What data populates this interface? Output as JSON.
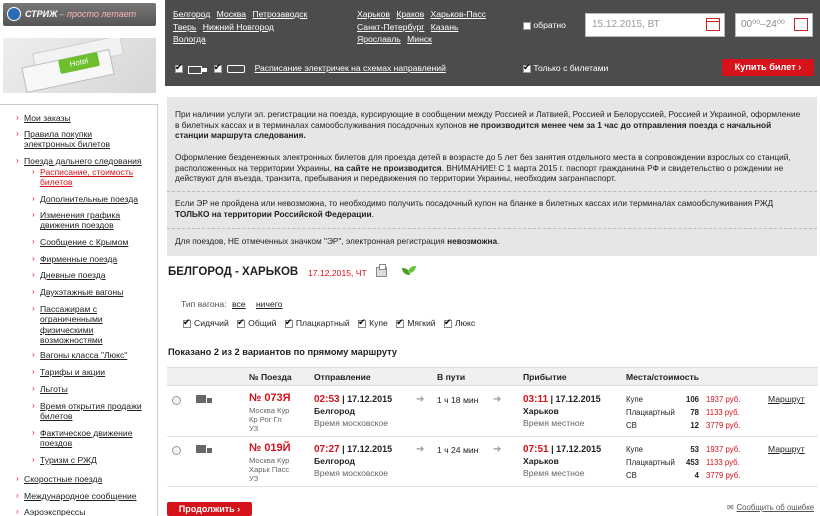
{
  "logo": {
    "brand": "СТРИЖ",
    "slogan": "– просто летает"
  },
  "hotel_banner": {
    "label": "Hotel"
  },
  "search": {
    "from_cities": [
      "Белгород",
      "Москва",
      "Петрозаводск",
      "Тверь",
      "Нижний Новгород",
      "Вологда"
    ],
    "to_cities": [
      "Харьков",
      "Краков",
      "Харьков-Пасс",
      "Санкт-Петербург",
      "Казань",
      "Ярославль",
      "Минск"
    ],
    "round_trip_label": "обратно",
    "date_value": "15.12.2015, ВТ",
    "time_value": "00⁰⁰–24⁰⁰",
    "suburban_link": "Расписание электричек на схемах направлений",
    "only_tickets_label": "Только с билетами",
    "buy_button": "Купить билет ›"
  },
  "sidebar": {
    "items": [
      "Мои заказы",
      "Правила покупки электронных билетов",
      "Поезда дальнего следования",
      "Расписание, стоимость билетов",
      "Дополнительные поезда",
      "Изменения графика движения поездов",
      "Сообщение с Крымом",
      "Фирменные поезда",
      "Дневные поезда",
      "Двухэтажные вагоны",
      "Пассажирам с ограниченными физическими возможностями",
      "Вагоны класса \"Люкс\"",
      "Тарифы и акции",
      "Льготы",
      "Время открытия продажи билетов",
      "Фактическое движение поездов",
      "Туризм с РЖД",
      "Скоростные поезда",
      "Международное сообщение",
      "Аэроэкспрессы"
    ]
  },
  "info": {
    "p1_a": "При наличии услуги эл. регистрации на поезда, курсирующие в сообщении между Россией и Латвией, Россией и Белоруссией, Россией и Украиной, оформление в билетных кассах и в терминалах самообслуживания посадочных купонов ",
    "p1_b": "не производится менее чем за 1 час до отправления поезда с начальной станции маршрута следования.",
    "p2": "Оформление безденежных электронных билетов для проезда детей в возрасте до 5 лет без занятия отдельного места в сопровождении взрослых со станций, расположенных на территории Украины, ",
    "p2_b": "на сайте не производится",
    "p2_c": ". ВНИМАНИЕ! С 1 марта 2015 г. паспорт гражданина РФ и свидетельство о рождении не действуют для въезда, транзита, пребывания и передвижения по территории Украины, необходим загранпаспорт.",
    "p3_a": "Если ЭР не пройдена или невозможна, то необходимо получить посадочный купон на бланке в билетных кассах или терминалах самообслуживания РЖД ",
    "p3_b": "ТОЛЬКО на территории Российской Федерации",
    "p3_c": ".",
    "p4_a": "Для поездов, НЕ отмеченных значком \"ЭР\", электронная регистрация ",
    "p4_b": "невозможна",
    "p4_c": "."
  },
  "route": {
    "title": "БЕЛГОРОД - ХАРЬКОВ",
    "date": "17.12.2015, ЧТ"
  },
  "filter": {
    "label": "Тип вагона:",
    "all": "все",
    "none": "ничего",
    "types": [
      "Сидячий",
      "Общий",
      "Плацкартный",
      "Купе",
      "Мягкий",
      "Люкс"
    ]
  },
  "results": {
    "shown": "Показано 2 из 2 вариантов по прямому маршруту",
    "headers": {
      "train": "№ Поезда",
      "departure": "Отправление",
      "travel": "В пути",
      "arrival": "Прибытие",
      "seats": "Места/стоимость"
    },
    "rows": [
      {
        "number": "№ 073Я",
        "route_1": "Москва Кур",
        "route_2": "Кр Рог Гл",
        "tag": "УЗ",
        "dep_time": "02:53",
        "dep_date": " | 17.12.2015",
        "dep_city": "Белгород",
        "dep_tz": "Время московское",
        "duration": "1 ч 18 мин",
        "arr_time": "03:11",
        "arr_date": " | 17.12.2015",
        "arr_city": "Харьков",
        "arr_tz": "Время местное",
        "seats": [
          {
            "cls": "Купе",
            "count": "106",
            "price": "1937 руб."
          },
          {
            "cls": "Плацкартный",
            "count": "78",
            "price": "1133 руб."
          },
          {
            "cls": "СВ",
            "count": "12",
            "price": "3779 руб."
          }
        ],
        "route_link": "Маршрут"
      },
      {
        "number": "№ 019Й",
        "route_1": "Москва Кур",
        "route_2": "Харьк Пасс",
        "tag": "УЗ",
        "dep_time": "07:27",
        "dep_date": " | 17.12.2015",
        "dep_city": "Белгород",
        "dep_tz": "Время московское",
        "duration": "1 ч 24 мин",
        "arr_time": "07:51",
        "arr_date": " | 17.12.2015",
        "arr_city": "Харьков",
        "arr_tz": "Время местное",
        "seats": [
          {
            "cls": "Купе",
            "count": "53",
            "price": "1937 руб."
          },
          {
            "cls": "Плацкартный",
            "count": "453",
            "price": "1133 руб."
          },
          {
            "cls": "СВ",
            "count": "4",
            "price": "3779 руб."
          }
        ],
        "route_link": "Маршрут"
      }
    ]
  },
  "footer": {
    "continue": "Продолжить ›",
    "error_link": "Сообщить об ошибке"
  }
}
